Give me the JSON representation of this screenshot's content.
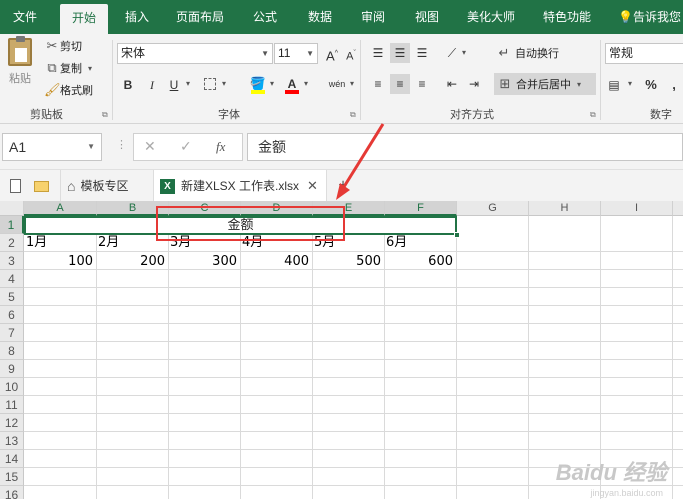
{
  "tabs": [
    "文件",
    "开始",
    "插入",
    "页面布局",
    "公式",
    "数据",
    "审阅",
    "视图",
    "美化大师",
    "特色功能"
  ],
  "tell_me": "告诉我您",
  "clipboard": {
    "paste": "粘贴",
    "cut": "剪切",
    "copy": "复制",
    "format_painter": "格式刷",
    "label": "剪贴板"
  },
  "font": {
    "name": "宋体",
    "size": "11",
    "grow": "A",
    "shrink": "A",
    "bold": "B",
    "italic": "I",
    "underline": "U",
    "wen": "wén",
    "label": "字体"
  },
  "alignment": {
    "wrap_text": "自动换行",
    "merge_center": "合并后居中",
    "label": "对齐方式"
  },
  "number": {
    "format": "常规",
    "percent": "%",
    "comma": ",",
    "label": "数字"
  },
  "formula_bar": {
    "name_box": "A1",
    "fx": "fx",
    "cancel": "✕",
    "enter": "✓",
    "content": "金额"
  },
  "file_tabs": {
    "template": "模板专区",
    "workbook": "新建XLSX 工作表.xlsx",
    "new": "+"
  },
  "columns": [
    "A",
    "B",
    "C",
    "D",
    "E",
    "F",
    "G",
    "H",
    "I"
  ],
  "rows": [
    "1",
    "2",
    "3",
    "4",
    "5",
    "6",
    "7",
    "8",
    "9",
    "10",
    "11",
    "12",
    "13",
    "14",
    "15",
    "16"
  ],
  "sheet": {
    "merged_title": "金额",
    "months": [
      "1月",
      "2月",
      "3月",
      "4月",
      "5月",
      "6月"
    ],
    "values": [
      "100",
      "200",
      "300",
      "400",
      "500",
      "600"
    ]
  },
  "watermark": {
    "brand": "Baidu 经验",
    "url": "jingyan.baidu.com"
  },
  "colors": {
    "excel_green": "#217346",
    "annotation_red": "#e53935"
  }
}
